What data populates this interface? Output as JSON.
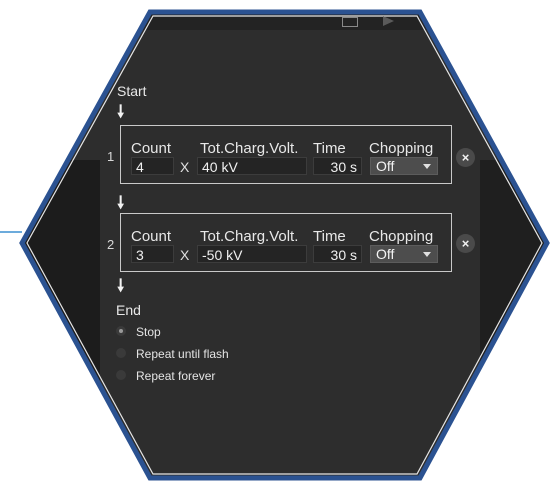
{
  "sequence": {
    "start_label": "Start",
    "end_label": "End",
    "steps": [
      {
        "index": "1",
        "count_header": "Count",
        "count_value": "4",
        "multiply": "X",
        "voltage_header": "Tot.Charg.Volt.",
        "voltage_value": "40 kV",
        "time_header": "Time",
        "time_value": "30 s",
        "chopping_header": "Chopping",
        "chopping_value": "Off",
        "remove_label": "×"
      },
      {
        "index": "2",
        "count_header": "Count",
        "count_value": "3",
        "multiply": "X",
        "voltage_header": "Tot.Charg.Volt.",
        "voltage_value": "-50 kV",
        "time_header": "Time",
        "time_value": "30 s",
        "chopping_header": "Chopping",
        "chopping_value": "Off",
        "remove_label": "×"
      }
    ],
    "end_options": [
      {
        "label": "Stop",
        "selected": true
      },
      {
        "label": "Repeat until flash",
        "selected": false
      },
      {
        "label": "Repeat forever",
        "selected": false
      }
    ]
  },
  "colors": {
    "frame": "#2b5291",
    "panel": "#2d2d2d",
    "side_panel": "#1f1f1f"
  },
  "icons": [
    "arrow-down-icon",
    "close-icon",
    "folder-icon",
    "play-icon"
  ]
}
